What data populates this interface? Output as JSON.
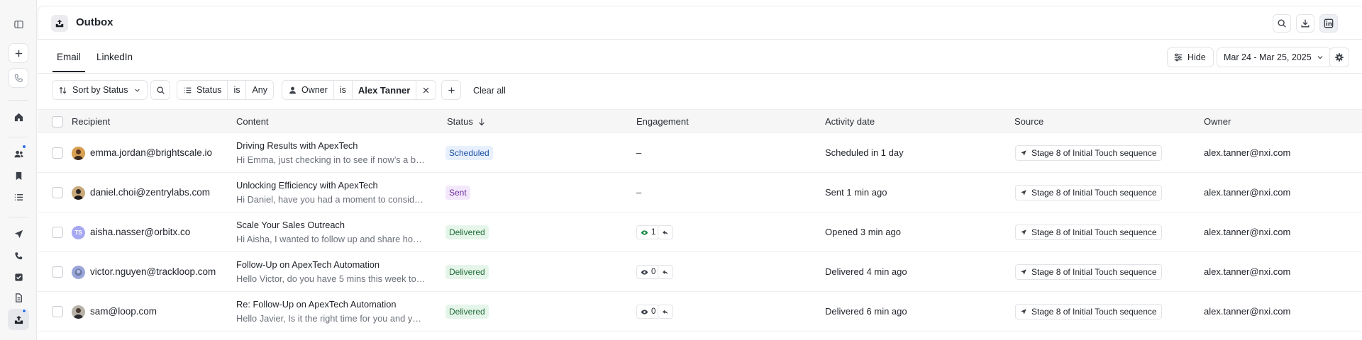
{
  "sidebar": {
    "icons": [
      "panel-toggle-icon",
      "plus-icon",
      "phone-icon",
      "home-icon",
      "people-icon",
      "bookmark-icon",
      "list-icon",
      "send-icon",
      "phone-icon",
      "check-square-icon",
      "document-icon",
      "outbox-icon"
    ]
  },
  "header": {
    "title": "Outbox",
    "actions": [
      "search-icon",
      "download-icon",
      "linkedin-icon"
    ]
  },
  "tabs": [
    {
      "label": "Email",
      "active": true
    },
    {
      "label": "LinkedIn",
      "active": false
    }
  ],
  "toolbar": {
    "hide_label": "Hide",
    "date_range": "Mar 24 - Mar 25, 2025"
  },
  "filters": {
    "sort_label": "Sort by Status",
    "status": {
      "field": "Status",
      "op": "is",
      "value": "Any"
    },
    "owner": {
      "field": "Owner",
      "op": "is",
      "value": "Alex Tanner"
    },
    "clear_all": "Clear all"
  },
  "table": {
    "columns": [
      "Recipient",
      "Content",
      "Status",
      "Engagement",
      "Activity date",
      "Source",
      "Owner"
    ],
    "rows": [
      {
        "recipient": "emma.jordan@brightscale.io",
        "subject": "Driving Results with ApexTech",
        "preview": "Hi Emma, just checking in to see if now’s a b…",
        "status": "Scheduled",
        "engagement": "–",
        "views": "",
        "activity": "Scheduled in 1 day",
        "source": "Stage 8 of Initial Touch sequence",
        "owner": "alex.tanner@nxi.com"
      },
      {
        "recipient": "daniel.choi@zentrylabs.com",
        "subject": "Unlocking Efficiency with ApexTech",
        "preview": "Hi Daniel, have you had a moment to consid…",
        "status": "Sent",
        "engagement": "–",
        "views": "",
        "activity": "Sent 1 min ago",
        "source": "Stage 8 of Initial Touch sequence",
        "owner": "alex.tanner@nxi.com"
      },
      {
        "recipient": "aisha.nasser@orbitx.co",
        "avatar_initials": "TS",
        "subject": "Scale Your Sales Outreach",
        "preview": "Hi Aisha, I wanted to follow up and share ho…",
        "status": "Delivered",
        "engagement": "",
        "views": "1",
        "activity": "Opened 3 min ago",
        "source": "Stage 8 of Initial Touch sequence",
        "owner": "alex.tanner@nxi.com"
      },
      {
        "recipient": "victor.nguyen@trackloop.com",
        "subject": "Follow-Up on ApexTech Automation",
        "preview": "Hello Victor, do you have 5 mins this week to …",
        "status": "Delivered",
        "engagement": "",
        "views": "0",
        "activity": "Delivered 4 min ago",
        "source": "Stage 8 of Initial Touch sequence",
        "owner": "alex.tanner@nxi.com"
      },
      {
        "recipient": "sam@loop.com",
        "subject": "Re: Follow-Up on ApexTech Automation",
        "preview": "Hello Javier, Is it the right time for you and y…",
        "status": "Delivered",
        "engagement": "",
        "views": "0",
        "activity": "Delivered 6 min ago",
        "source": "Stage 8 of Initial Touch sequence",
        "owner": "alex.tanner@nxi.com"
      }
    ]
  },
  "colors": {
    "scheduled_badge": "#e8f0fe",
    "sent_badge": "#f3e8fb",
    "delivered_badge": "#e6f5ea",
    "notification_dot": "#2b6be6",
    "opened_eye": "#1d8a46"
  }
}
